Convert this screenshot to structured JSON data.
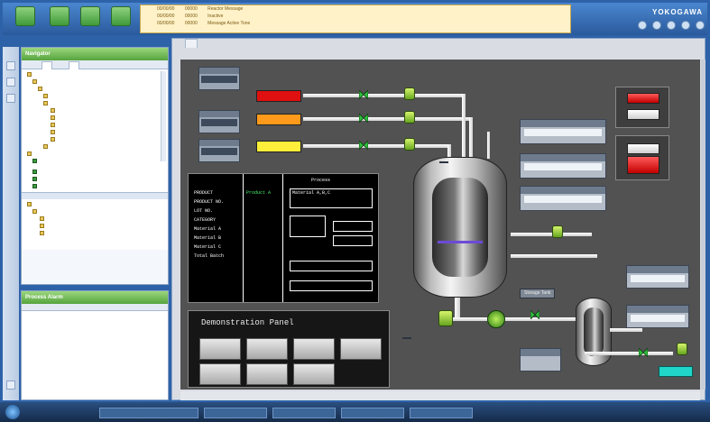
{
  "toolbar": {
    "buttons": [
      "",
      "",
      "",
      ""
    ],
    "alarms": [
      {
        "time": "00/00/00",
        "id": "00000",
        "text": "Reactor Message"
      },
      {
        "time": "00/00/00",
        "id": "00000",
        "text": "Inactive"
      },
      {
        "time": "00/00/00",
        "id": "00000",
        "text": "Message Active Tone"
      }
    ],
    "brand": "YOKOGAWA",
    "info1": "",
    "info2": ""
  },
  "navigator": {
    "title": "Navigator",
    "tabs": [
      "",
      ""
    ],
    "tree": [
      "",
      "",
      "",
      "",
      "",
      "",
      "",
      "",
      "",
      "",
      "",
      "",
      "",
      "",
      "",
      "",
      "",
      ""
    ],
    "section2_title": "",
    "tree2": [
      "",
      "",
      "",
      "",
      ""
    ]
  },
  "alarm_list": {
    "title": "Process Alarm",
    "columns": [
      "",
      ""
    ],
    "rows": [
      "",
      "",
      "",
      "",
      "",
      "",
      "",
      "",
      "",
      "",
      "",
      "",
      "",
      ""
    ]
  },
  "main": {
    "tab": "",
    "status": ""
  },
  "hmi": {
    "left_tags": [
      {
        "label": "",
        "value": ""
      },
      {
        "label": "",
        "value": ""
      },
      {
        "label": "",
        "value": ""
      }
    ],
    "materials": [
      {
        "label": "",
        "color": "#e01010"
      },
      {
        "label": "",
        "color": "#ff9a1a"
      },
      {
        "label": "",
        "color": "#ffef3a"
      }
    ],
    "product_panel": {
      "rows": [
        {
          "label": "PRODUCT",
          "value": "Product A"
        },
        {
          "label": "PRODUCT NO.",
          "value": ""
        },
        {
          "label": "LOT NO.",
          "value": ""
        },
        {
          "label": "CATEGORY",
          "value": ""
        },
        {
          "label": "Material A",
          "value": ""
        },
        {
          "label": "Material B",
          "value": ""
        },
        {
          "label": "Material C",
          "value": ""
        },
        {
          "label": "Total Batch",
          "value": ""
        }
      ],
      "process_title": "Process",
      "process_steps": [
        "Material A,B,C",
        "",
        "",
        "",
        "",
        ""
      ]
    },
    "demo_panel": {
      "title": "Demonstration Panel",
      "buttons": [
        "",
        "",
        "",
        "",
        "",
        "",
        ""
      ]
    },
    "reactor_label": "",
    "right_tags": [
      {
        "label": "",
        "value": ""
      },
      {
        "label": "",
        "value": ""
      },
      {
        "label": "",
        "value": ""
      }
    ],
    "storage_label": "Storage Tank",
    "storage_tags": [
      {
        "label": "",
        "value": ""
      },
      {
        "label": "",
        "value": ""
      }
    ],
    "small_tags": [
      "",
      ""
    ],
    "pump_label": "",
    "alarm_button_label": ""
  },
  "taskbar": {
    "tasks": [
      "",
      "",
      "",
      "",
      ""
    ],
    "clock": ""
  }
}
